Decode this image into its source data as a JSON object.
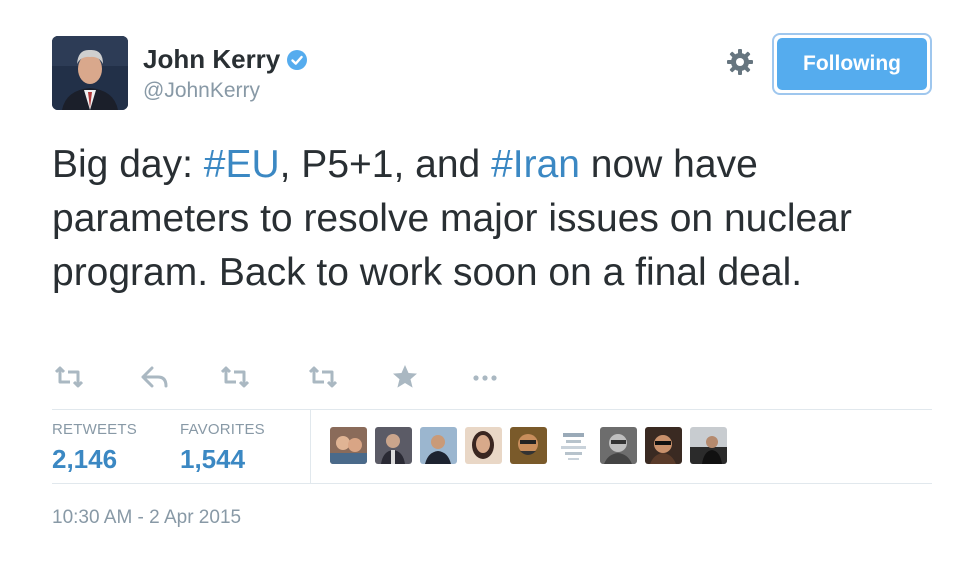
{
  "author": {
    "name": "John Kerry",
    "handle": "@JohnKerry",
    "avatar_icon": "profile-photo",
    "verified_icon": "verified-badge-icon"
  },
  "follow_button": {
    "label": "Following",
    "color": "#55acee"
  },
  "settings_icon": "gear-icon",
  "tweet": {
    "segments": [
      {
        "text": "Big day: ",
        "type": "text"
      },
      {
        "text": "#EU",
        "type": "hashtag"
      },
      {
        "text": ", P5+1, and ",
        "type": "text"
      },
      {
        "text": "#Iran",
        "type": "hashtag"
      },
      {
        "text": " now have parameters to resolve major issues on nuclear program. Back to work soon on a final deal.",
        "type": "text"
      }
    ],
    "hashtag_color": "#3b88c3"
  },
  "actions": [
    "retweet-icon",
    "reply-icon",
    "retweet-icon",
    "retweet-icon",
    "favorite-star-icon",
    "more-icon"
  ],
  "stats": {
    "retweets_label": "RETWEETS",
    "retweets_value": "2,146",
    "favorites_label": "FAVORITES",
    "favorites_value": "1,544"
  },
  "favoriters_count_shown": 9,
  "timestamp": "10:30 AM - 2 Apr 2015"
}
